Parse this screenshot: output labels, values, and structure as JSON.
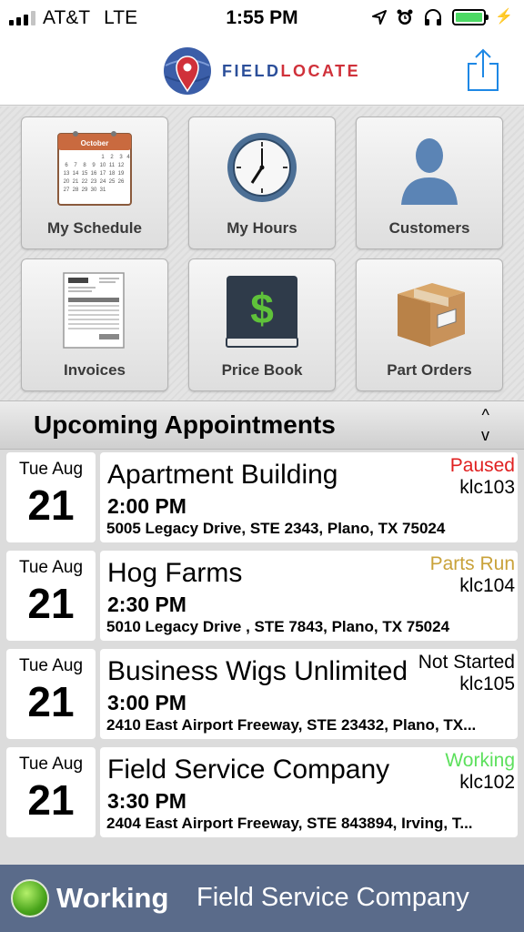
{
  "status_bar": {
    "carrier": "AT&T",
    "network": "LTE",
    "time": "1:55 PM",
    "icons": [
      "location-arrow-icon",
      "alarm-icon",
      "headphones-icon",
      "battery-icon",
      "charging-bolt-icon"
    ],
    "battery_color": "#4cd964"
  },
  "header": {
    "logo_part1": "FIELD",
    "logo_part2": "LOCATE",
    "logo_colors": {
      "field": "#2c4f9a",
      "locate": "#d0313a"
    },
    "share_icon": "share-icon"
  },
  "tiles": [
    {
      "label": "My Schedule",
      "icon": "calendar-icon",
      "calendar_month": "October"
    },
    {
      "label": "My Hours",
      "icon": "clock-icon"
    },
    {
      "label": "Customers",
      "icon": "person-icon"
    },
    {
      "label": "Invoices",
      "icon": "invoice-icon"
    },
    {
      "label": "Price Book",
      "icon": "price-book-icon",
      "glyph": "$"
    },
    {
      "label": "Part Orders",
      "icon": "package-icon"
    }
  ],
  "appointments_section": {
    "title": "Upcoming Appointments",
    "sort_up": "^",
    "sort_down": "v"
  },
  "appointments": [
    {
      "day": "Tue Aug",
      "date": "21",
      "name": "Apartment Building",
      "time": "2:00 PM",
      "address": "5005 Legacy Drive, STE 2343, Plano, TX 75024",
      "status": "Paused",
      "status_color": "#e02020",
      "code": "klc103"
    },
    {
      "day": "Tue Aug",
      "date": "21",
      "name": "Hog Farms",
      "time": "2:30 PM",
      "address": "5010 Legacy Drive , STE 7843, Plano, TX 75024",
      "status": "Parts Run",
      "status_color": "#c9a23a",
      "code": "klc104"
    },
    {
      "day": "Tue Aug",
      "date": "21",
      "name": "Business Wigs Unlimited",
      "time": "3:00 PM",
      "address": "2410 East Airport Freeway, STE 23432, Plano, TX...",
      "status": "Not Started",
      "status_color": "#000000",
      "code": "klc105"
    },
    {
      "day": "Tue Aug",
      "date": "21",
      "name": "Field Service Company",
      "time": "3:30 PM",
      "address": "2404 East Airport Freeway, STE 843894, Irving, T...",
      "status": "Working",
      "status_color": "#5ce05c",
      "code": "klc102"
    }
  ],
  "bottom_bar": {
    "status": "Working",
    "job": "Field Service Company",
    "bar_color": "#5a6b8a",
    "dot_color": "#4aa51c"
  }
}
